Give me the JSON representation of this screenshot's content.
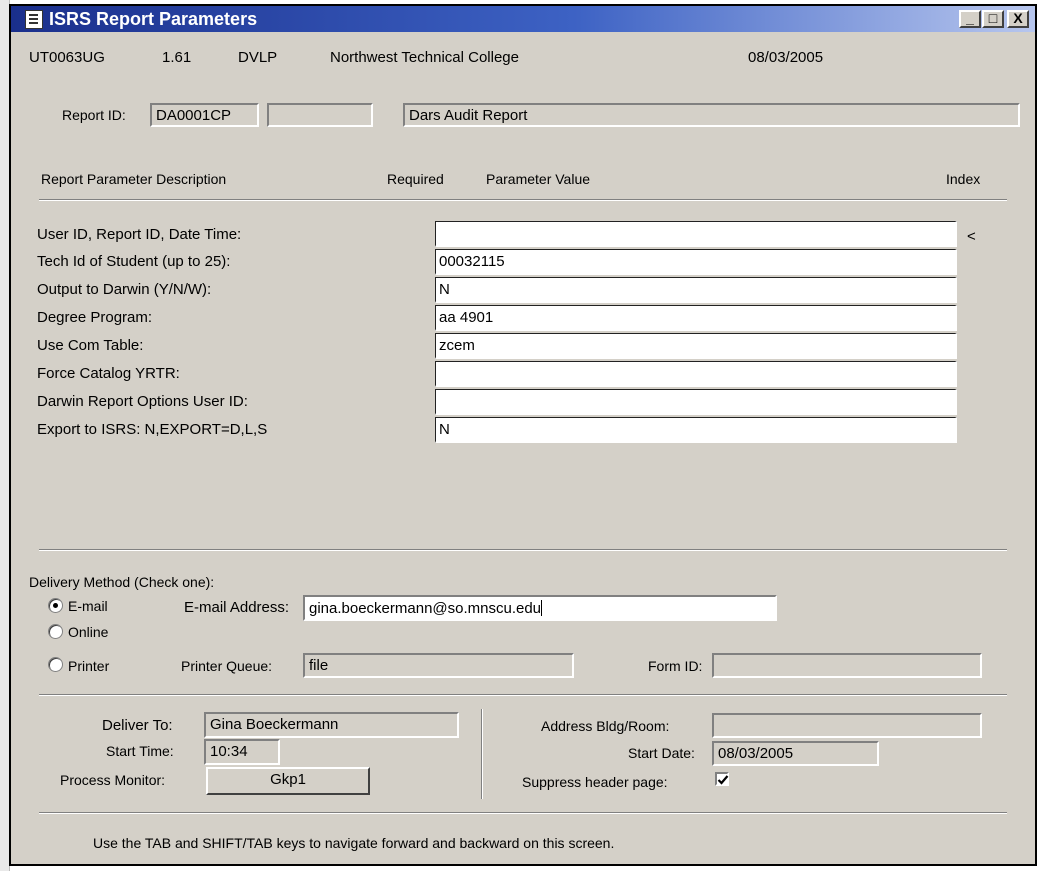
{
  "window": {
    "title": "ISRS Report Parameters",
    "controls": {
      "minimize": "_",
      "maximize": "□",
      "close": "X"
    }
  },
  "header": {
    "code": "UT0063UG",
    "version": "1.61",
    "env": "DVLP",
    "college": "Northwest Technical College",
    "date": "08/03/2005"
  },
  "report": {
    "label": "Report ID:",
    "id": "DA0001CP",
    "extra": "",
    "name": "Dars Audit Report"
  },
  "columns": {
    "description": "Report Parameter Description",
    "required": "Required",
    "value": "Parameter Value",
    "index": "Index"
  },
  "parameters": [
    {
      "label": "User ID, Report ID, Date Time:",
      "value": ""
    },
    {
      "label": "Tech Id of Student (up to 25):",
      "value": "00032115"
    },
    {
      "label": "Output to Darwin (Y/N/W):",
      "value": "N"
    },
    {
      "label": "Degree Program:",
      "value": "aa  4901"
    },
    {
      "label": "Use Com Table:",
      "value": "zcem"
    },
    {
      "label": "Force Catalog YRTR:",
      "value": ""
    },
    {
      "label": "Darwin Report Options User ID:",
      "value": ""
    },
    {
      "label": "Export to ISRS: N,EXPORT=D,L,S",
      "value": "N"
    }
  ],
  "index_marker": "<",
  "delivery": {
    "heading": "Delivery Method (Check one):",
    "options": [
      {
        "label": "E-mail",
        "selected": true
      },
      {
        "label": "Online",
        "selected": false
      },
      {
        "label": "Printer",
        "selected": false
      }
    ],
    "email_label": "E-mail Address:",
    "email_value": "gina.boeckermann@so.mnscu.edu",
    "printer_label": "Printer Queue:",
    "printer_value": "file",
    "form_label": "Form ID:",
    "form_value": ""
  },
  "footer": {
    "deliver_to_label": "Deliver To:",
    "deliver_to_value": "Gina Boeckermann",
    "start_time_label": "Start Time:",
    "start_time_value": "10:34",
    "process_monitor_label": "Process Monitor:",
    "process_monitor_button": "Gkp1",
    "address_label": "Address Bldg/Room:",
    "address_value": "",
    "start_date_label": "Start Date:",
    "start_date_value": "08/03/2005",
    "suppress_label": "Suppress header page:",
    "suppress_checked": true
  },
  "hint": "Use the TAB and SHIFT/TAB keys to navigate forward and backward on this screen."
}
